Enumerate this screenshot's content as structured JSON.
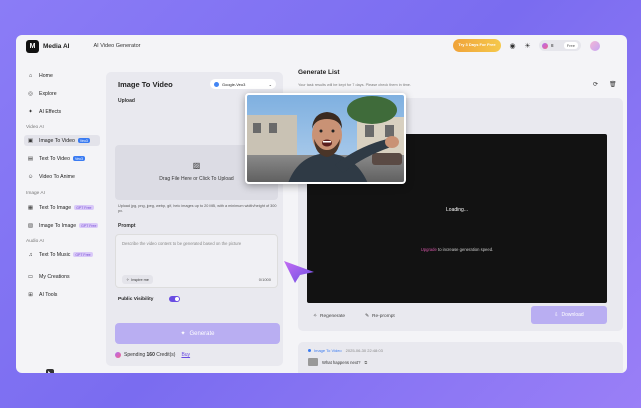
{
  "header": {
    "brand": "Media AI",
    "page_name": "AI Video Generator",
    "promo": "Try 3 Days For Free",
    "credits_count": "8",
    "plan": "Free"
  },
  "sidebar": {
    "items": [
      {
        "label": "Home",
        "icon": "home-icon"
      },
      {
        "label": "Explore",
        "icon": "compass-icon"
      },
      {
        "label": "AI Effects",
        "icon": "sparkle-icon"
      }
    ],
    "section_video": "Video AI",
    "video_items": [
      {
        "label": "Image To Video",
        "tag": "Veo3"
      },
      {
        "label": "Text To Video",
        "tag": "Veo3"
      },
      {
        "label": "Video To Anime",
        "tag": ""
      }
    ],
    "section_image": "Image AI",
    "image_items": [
      {
        "label": "Text To Image",
        "tag": "GPT Free"
      },
      {
        "label": "Image To Image",
        "tag": "GPT Free"
      }
    ],
    "section_audio": "Audio AI",
    "audio_items": [
      {
        "label": "Text To Music",
        "tag": "GPT Free"
      }
    ],
    "bottom_items": [
      {
        "label": "My Creations"
      },
      {
        "label": "AI Tools"
      }
    ]
  },
  "panel": {
    "title": "Image To Video",
    "model": "Google-Veo3",
    "upload_label": "Upload",
    "upload_text": "Drag File Here or Click To Upload",
    "upload_hint": "Upload jpg, png, jpeg, webp, gif, heic images up to 20 MB, with a minimum width/height of 300 px.",
    "prompt_label": "Prompt",
    "prompt_placeholder": "Describe the video content to be generated based on the picture",
    "inspire": "Inspire me",
    "counter": "0/1000",
    "public_visibility": "Public Visibility",
    "generate": "Generate",
    "spending_prefix": "Spending",
    "spending_amount": "160",
    "spending_suffix": "Credit(s)",
    "buy": "Buy"
  },
  "results": {
    "title": "Generate List",
    "subtitle": "Your task results will be kept for 7 days. Please check them in time.",
    "loading": "Loading...",
    "upgrade": "Upgrade",
    "upgrade_rest": "to increase generation speed.",
    "regenerate": "Regenerate",
    "reprompt": "Re-prompt",
    "download": "Download"
  },
  "history": {
    "type": "Image To Video",
    "timestamp": "2025-06-30 22:48:03",
    "text": "What happens next?"
  },
  "colors": {
    "accent": "#6a4de2",
    "button_disabled": "#b9aef2",
    "background_gradient": "#8b7cf6"
  }
}
